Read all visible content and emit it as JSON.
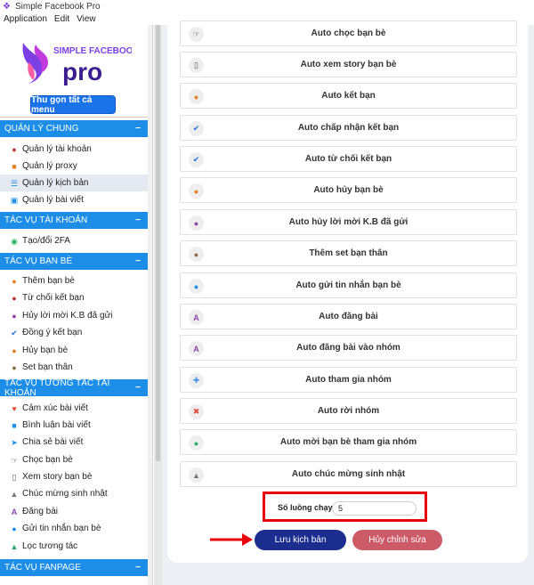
{
  "window": {
    "title": "Simple Facebook Pro"
  },
  "menubar": [
    "Application",
    "Edit",
    "View"
  ],
  "logo": {
    "line1": "SIMPLE FACEBOOK",
    "line2": "pro"
  },
  "sidebar": {
    "collapse_label": "Thu gọn tất cả menu",
    "sections": [
      {
        "title": "QUẢN LÝ CHUNG",
        "items": [
          {
            "label": "Quản lý tài khoản",
            "icon": "user-icon"
          },
          {
            "label": "Quản lý proxy",
            "icon": "proxy-icon"
          },
          {
            "label": "Quản lý kịch bản",
            "icon": "script-icon",
            "active": true
          },
          {
            "label": "Quản lý bài viết",
            "icon": "post-icon"
          }
        ]
      },
      {
        "title": "TÁC VỤ TÀI KHOẢN",
        "items": [
          {
            "label": "Tạo/đổi 2FA",
            "icon": "shield-icon"
          }
        ]
      },
      {
        "title": "TÁC VỤ BẠN BÈ",
        "items": [
          {
            "label": "Thêm bạn bè",
            "icon": "add-friend-icon"
          },
          {
            "label": "Từ chối kết bạn",
            "icon": "reject-icon"
          },
          {
            "label": "Hủy lời mời K.B đã gửi",
            "icon": "cancel-invite-icon"
          },
          {
            "label": "Đồng ý kết bạn",
            "icon": "check-icon"
          },
          {
            "label": "Hủy bạn bè",
            "icon": "unfriend-icon"
          },
          {
            "label": "Set bạn thân",
            "icon": "close-friend-icon"
          }
        ]
      },
      {
        "title": "TÁC VỤ TƯƠNG TÁC TÀI KHOẢN",
        "items": [
          {
            "label": "Cảm xúc bài viết",
            "icon": "heart-icon"
          },
          {
            "label": "Bình luận bài viết",
            "icon": "comment-icon"
          },
          {
            "label": "Chia sẻ bài viết",
            "icon": "share-icon"
          },
          {
            "label": "Chọc bạn bè",
            "icon": "poke-icon"
          },
          {
            "label": "Xem story bạn bè",
            "icon": "story-icon"
          },
          {
            "label": "Chúc mừng sinh nhật",
            "icon": "birthday-icon"
          },
          {
            "label": "Đăng bài",
            "icon": "post-a-icon"
          },
          {
            "label": "Gửi tin nhắn bạn bè",
            "icon": "messenger-icon"
          },
          {
            "label": "Lọc tương tác",
            "icon": "filter-icon"
          }
        ]
      },
      {
        "title": "TÁC VỤ FANPAGE",
        "items": []
      }
    ]
  },
  "actions": [
    {
      "label": "Auto chọc bạn bè",
      "icon": "poke-icon"
    },
    {
      "label": "Auto xem story bạn bè",
      "icon": "story-icon"
    },
    {
      "label": "Auto kết bạn",
      "icon": "add-friend-icon"
    },
    {
      "label": "Auto chấp nhận kết bạn",
      "icon": "check-icon"
    },
    {
      "label": "Auto từ chối kết bạn",
      "icon": "check-icon"
    },
    {
      "label": "Auto hủy bạn bè",
      "icon": "unfriend-icon"
    },
    {
      "label": "Auto hủy lời mời K.B đã gửi",
      "icon": "cancel-invite-icon"
    },
    {
      "label": "Thêm set bạn thân",
      "icon": "close-friend-icon"
    },
    {
      "label": "Auto gửi tin nhắn bạn bè",
      "icon": "messenger-icon"
    },
    {
      "label": "Auto đăng bài",
      "icon": "post-a-icon"
    },
    {
      "label": "Auto đăng bài vào nhóm",
      "icon": "post-a-icon"
    },
    {
      "label": "Auto tham gia nhóm",
      "icon": "join-group-icon"
    },
    {
      "label": "Auto rời nhóm",
      "icon": "leave-group-icon"
    },
    {
      "label": "Auto mời bạn bè tham gia nhóm",
      "icon": "invite-group-icon"
    },
    {
      "label": "Auto chúc mừng sinh nhật",
      "icon": "birthday-icon"
    }
  ],
  "threads": {
    "label": "Số luồng chạy:",
    "value": "5"
  },
  "buttons": {
    "save": "Lưu kịch bản",
    "cancel": "Hủy chỉnh sửa"
  },
  "colors": {
    "accent": "#1c8ee8",
    "save": "#1b2e8f",
    "cancel": "#cc5a67",
    "highlight": "#e8000b"
  }
}
